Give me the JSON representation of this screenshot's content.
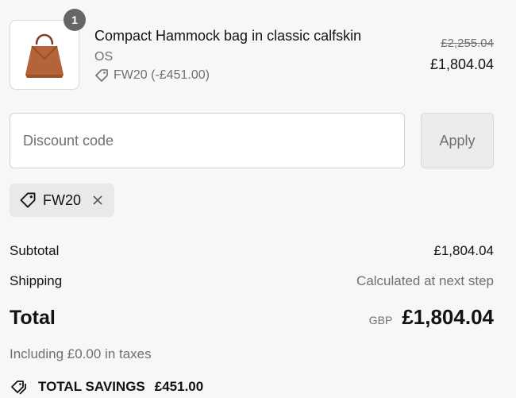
{
  "product": {
    "quantity": "1",
    "title": "Compact Hammock bag in classic calfskin",
    "variant": "OS",
    "discount_label": "FW20 (-£451.00)",
    "price_original": "£2,255.04",
    "price_current": "£1,804.04",
    "image_icon": "handbag-image"
  },
  "discount": {
    "placeholder": "Discount code",
    "apply_label": "Apply",
    "applied_code": "FW20"
  },
  "summary": {
    "subtotal_label": "Subtotal",
    "subtotal_value": "£1,804.04",
    "shipping_label": "Shipping",
    "shipping_value": "Calculated at next step",
    "total_label": "Total",
    "total_currency": "GBP",
    "total_value": "£1,804.04",
    "taxes_note": "Including £0.00 in taxes",
    "savings_label": "TOTAL SAVINGS",
    "savings_value": "£451.00"
  },
  "colors": {
    "background": "#f7f7f7",
    "text": "#121212",
    "muted": "#707070",
    "bag": "#b5643a"
  }
}
